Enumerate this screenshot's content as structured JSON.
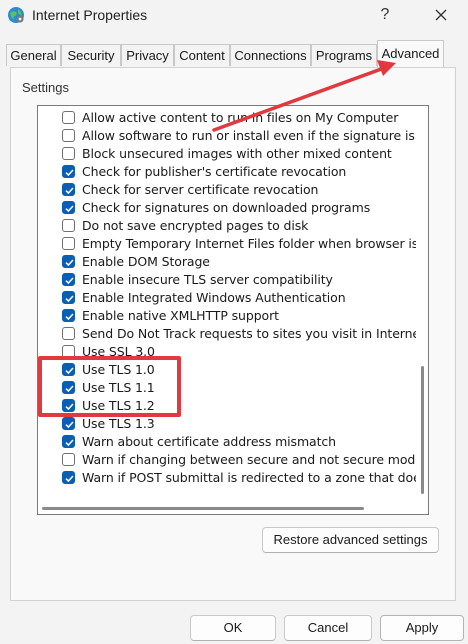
{
  "window": {
    "title": "Internet Properties",
    "help_label": "?",
    "app_icon": "globe-settings-icon",
    "close_icon": "close-icon"
  },
  "tabs": [
    {
      "label": "General"
    },
    {
      "label": "Security"
    },
    {
      "label": "Privacy"
    },
    {
      "label": "Content"
    },
    {
      "label": "Connections"
    },
    {
      "label": "Programs"
    },
    {
      "label": "Advanced",
      "active": true
    }
  ],
  "settings": {
    "label": "Settings",
    "items": [
      {
        "label": "Allow active content to run in files on My Computer",
        "checked": false
      },
      {
        "label": "Allow software to run or install even if the signature is inv",
        "checked": false
      },
      {
        "label": "Block unsecured images with other mixed content",
        "checked": false
      },
      {
        "label": "Check for publisher's certificate revocation",
        "checked": true
      },
      {
        "label": "Check for server certificate revocation",
        "checked": true
      },
      {
        "label": "Check for signatures on downloaded programs",
        "checked": true
      },
      {
        "label": "Do not save encrypted pages to disk",
        "checked": false
      },
      {
        "label": "Empty Temporary Internet Files folder when browser is cl",
        "checked": false
      },
      {
        "label": "Enable DOM Storage",
        "checked": true
      },
      {
        "label": "Enable insecure TLS server compatibility",
        "checked": true
      },
      {
        "label": "Enable Integrated Windows Authentication",
        "checked": true
      },
      {
        "label": "Enable native XMLHTTP support",
        "checked": true
      },
      {
        "label": "Send Do Not Track requests to sites you visit in Internet E",
        "checked": false
      },
      {
        "label": "Use SSL 3.0",
        "checked": false
      },
      {
        "label": "Use TLS 1.0",
        "checked": true
      },
      {
        "label": "Use TLS 1.1",
        "checked": true
      },
      {
        "label": "Use TLS 1.2",
        "checked": true
      },
      {
        "label": "Use TLS 1.3",
        "checked": true
      },
      {
        "label": "Warn about certificate address mismatch",
        "checked": true
      },
      {
        "label": "Warn if changing between secure and not secure mode",
        "checked": false
      },
      {
        "label": "Warn if POST submittal is redirected to a zone that does n",
        "checked": true
      }
    ]
  },
  "buttons": {
    "restore": "Restore advanced settings",
    "ok": "OK",
    "cancel": "Cancel",
    "apply": "Apply"
  },
  "colors": {
    "accent": "#0a5fb4",
    "annotation": "#e0393e"
  }
}
